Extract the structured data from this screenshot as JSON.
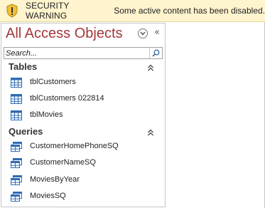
{
  "security_bar": {
    "title": "SECURITY WARNING",
    "message": "Some active content has been disabled.",
    "icon": "warning-shield-icon",
    "background": "#fff4ce"
  },
  "nav_pane": {
    "title": "All Access Objects",
    "title_color": "#a4373a",
    "menu_icon": "chevron-down-circle-icon",
    "collapse_glyph": "«",
    "search": {
      "placeholder": "Search...",
      "value": ""
    },
    "groups": [
      {
        "label": "Tables",
        "items": [
          {
            "label": "tblCustomers",
            "icon": "table-icon"
          },
          {
            "label": "tblCustomers 022814",
            "icon": "table-icon"
          },
          {
            "label": "tblMovies",
            "icon": "table-icon"
          }
        ]
      },
      {
        "label": "Queries",
        "items": [
          {
            "label": "CustomerHomePhoneSQ",
            "icon": "query-icon"
          },
          {
            "label": "CustomerNameSQ",
            "icon": "query-icon"
          },
          {
            "label": "MoviesByYear",
            "icon": "query-icon"
          },
          {
            "label": "MoviesSQ",
            "icon": "query-icon"
          }
        ]
      }
    ]
  }
}
